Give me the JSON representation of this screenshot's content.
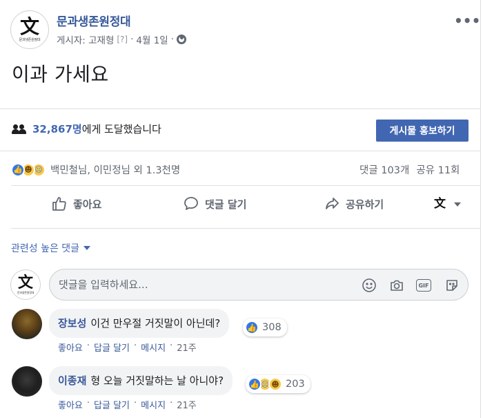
{
  "post": {
    "page_name": "문과생존원정대",
    "avatar_glyph": "文",
    "avatar_caption": "문과생존원정대",
    "author_line": "게시자: 고재형",
    "author_help": "[?]",
    "sep": "·",
    "date": "4월 1일",
    "privacy_icon": "globe-icon",
    "more_label": "•••",
    "text": "이과 가세요"
  },
  "reach": {
    "icon": "people-icon",
    "count": "32,867명",
    "text": "에게 도달했습니다",
    "boost_label": "게시물 홍보하기"
  },
  "reactions": {
    "icons": [
      "like",
      "haha",
      "sad"
    ],
    "names": "백민철님, 이민정님 외 1.3천명",
    "comments": "댓글 103개",
    "shares": "공유 11회"
  },
  "actions": {
    "like": "좋아요",
    "comment": "댓글 달기",
    "share": "공유하기",
    "as_page_glyph": "文"
  },
  "sort": {
    "label": "관련성 높은 댓글"
  },
  "composer": {
    "placeholder": "댓글을 입력하세요...",
    "icons": [
      "emoji-icon",
      "camera-icon",
      "gif-icon",
      "sticker-icon"
    ],
    "gif_label": "GIF"
  },
  "comments": [
    {
      "author": "장보성",
      "text": "이건 만우절 거짓말이 아닌데?",
      "reaction_count": "308",
      "like": "좋아요",
      "reply": "답글 달기",
      "message": "메시지",
      "age": "21주"
    },
    {
      "author": "이종재",
      "text": "형 오늘 거짓말하는 날 아니야?",
      "reaction_count": "203",
      "like": "좋아요",
      "reply": "답글 달기",
      "message": "메시지",
      "age": "21주"
    }
  ],
  "colors": {
    "link": "#365899",
    "accent": "#4267b2",
    "muted": "#606770",
    "divider": "#dddfe2",
    "bubble": "#f2f3f5"
  }
}
